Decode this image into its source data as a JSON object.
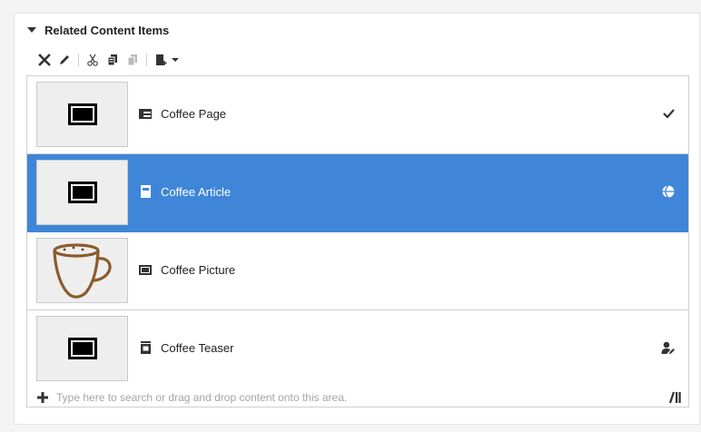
{
  "panel": {
    "title": "Related Content Items"
  },
  "toolbar": {
    "items": [
      "remove-icon",
      "edit-icon",
      "cut-icon",
      "copy-icon",
      "paste-icon",
      "add-content-icon",
      "dropdown-arrow-icon"
    ]
  },
  "items": [
    {
      "title": "Coffee Page",
      "type_icon": "page-layout-icon",
      "thumbnail": "placeholder-picture-icon",
      "status_icon": "checkmark-icon",
      "selected": false
    },
    {
      "title": "Coffee Article",
      "type_icon": "article-icon",
      "thumbnail": "placeholder-picture-icon",
      "status_icon": "globe-published-icon",
      "selected": true
    },
    {
      "title": "Coffee Picture",
      "type_icon": "picture-icon",
      "thumbnail": "coffee-cup-image",
      "status_icon": "",
      "selected": false
    },
    {
      "title": "Coffee Teaser",
      "type_icon": "teaser-icon",
      "thumbnail": "placeholder-picture-icon",
      "status_icon": "user-edit-icon",
      "selected": false
    }
  ],
  "search": {
    "placeholder": "Type here to search or drag and drop content onto this area."
  },
  "colors": {
    "selected_row": "#3f86d8",
    "border": "#cfcfcf",
    "background": "#f4f4f4"
  }
}
